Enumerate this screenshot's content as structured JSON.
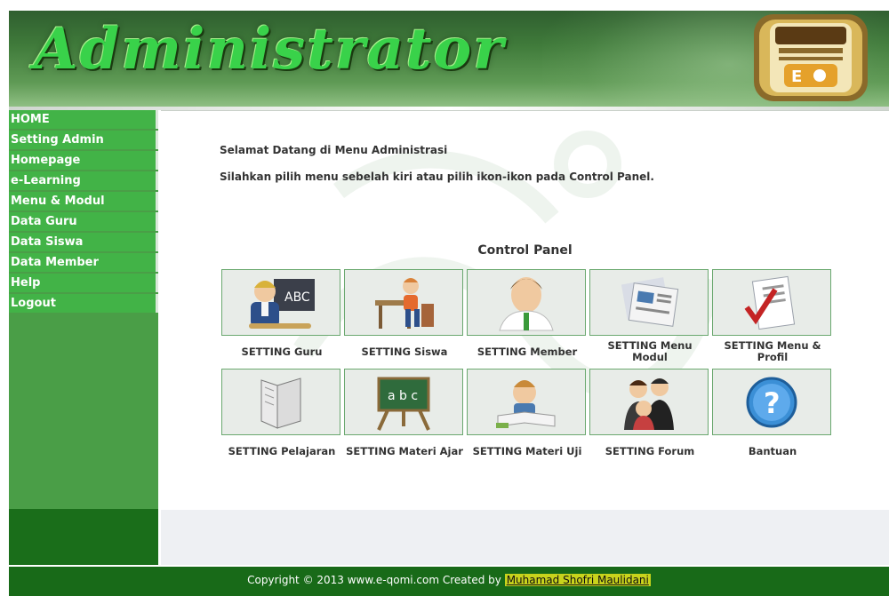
{
  "header": {
    "title": "Administrator",
    "logo_icon": "e-qomi-logo-icon",
    "accent": "#39d24a"
  },
  "sidebar": {
    "items": [
      {
        "label": "HOME"
      },
      {
        "label": "Setting Admin"
      },
      {
        "label": "Homepage"
      },
      {
        "label": "e-Learning"
      },
      {
        "label": "Menu & Modul"
      },
      {
        "label": "Data Guru"
      },
      {
        "label": "Data Siswa"
      },
      {
        "label": "Data Member"
      },
      {
        "label": "Help"
      },
      {
        "label": "Logout"
      }
    ]
  },
  "main": {
    "welcome": "Selamat Datang di Menu Administrasi",
    "instruction": "Silahkan pilih menu sebelah kiri atau pilih ikon-ikon pada Control Panel.",
    "control_panel_title": "Control Panel",
    "tiles": [
      {
        "label": "SETTING Guru",
        "icon": "teacher-icon"
      },
      {
        "label": "SETTING Siswa",
        "icon": "student-icon"
      },
      {
        "label": "SETTING Member",
        "icon": "member-icon"
      },
      {
        "label": "SETTING Menu Modul",
        "icon": "newspaper-icon"
      },
      {
        "label": "SETTING Menu & Profil",
        "icon": "checklist-icon"
      },
      {
        "label": "SETTING Pelajaran",
        "icon": "book-icon"
      },
      {
        "label": "SETTING Materi Ajar",
        "icon": "chalkboard-icon"
      },
      {
        "label": "SETTING Materi Uji",
        "icon": "exam-icon"
      },
      {
        "label": "SETTING Forum",
        "icon": "forum-icon"
      },
      {
        "label": "Bantuan",
        "icon": "help-icon"
      }
    ]
  },
  "footer": {
    "text": "Copyright © 2013 www.e-qomi.com Created by",
    "author": "Muhamad Shofri Maulidani"
  }
}
